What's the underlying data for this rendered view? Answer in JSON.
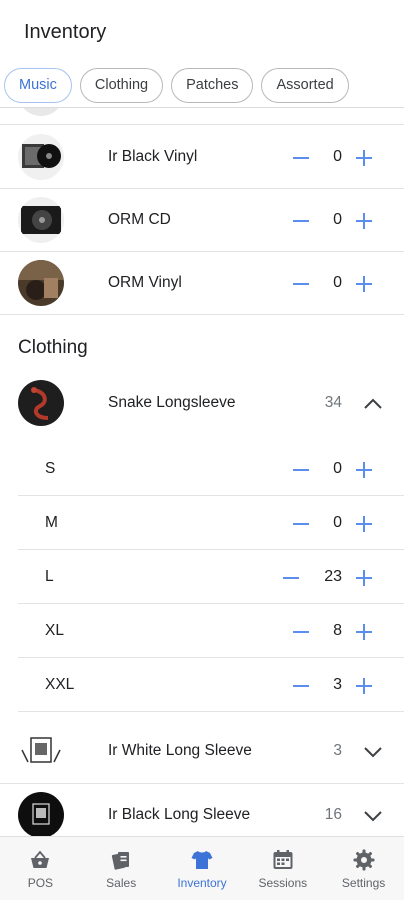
{
  "header": {
    "title": "Inventory",
    "tabs": [
      {
        "label": "Music",
        "active": true
      },
      {
        "label": "Clothing",
        "active": false
      },
      {
        "label": "Patches",
        "active": false
      },
      {
        "label": "Assorted",
        "active": false
      }
    ]
  },
  "music_items": [
    {
      "label": "Ir Black Vinyl",
      "qty": "0"
    },
    {
      "label": "ORM CD",
      "qty": "0"
    },
    {
      "label": "ORM Vinyl",
      "qty": "0"
    }
  ],
  "clothing": {
    "heading": "Clothing",
    "expanded_item": {
      "label": "Snake Longsleeve",
      "total": "34",
      "sizes": [
        {
          "label": "S",
          "qty": "0"
        },
        {
          "label": "M",
          "qty": "0"
        },
        {
          "label": "L",
          "qty": "23"
        },
        {
          "label": "XL",
          "qty": "8"
        },
        {
          "label": "XXL",
          "qty": "3"
        }
      ]
    },
    "collapsed_items": [
      {
        "label": "Ir White Long Sleeve",
        "total": "3"
      },
      {
        "label": "Ir Black Long Sleeve",
        "total": "16"
      }
    ]
  },
  "bottom_nav": [
    {
      "label": "POS",
      "icon": "basket-icon",
      "active": false
    },
    {
      "label": "Sales",
      "icon": "receipts-icon",
      "active": false
    },
    {
      "label": "Inventory",
      "icon": "tshirt-icon",
      "active": true
    },
    {
      "label": "Sessions",
      "icon": "calendar-icon",
      "active": false
    },
    {
      "label": "Settings",
      "icon": "gear-icon",
      "active": false
    }
  ],
  "colors": {
    "accent": "#3d73d6",
    "stepper": "#5b8def",
    "divider": "#e3e3e3"
  }
}
